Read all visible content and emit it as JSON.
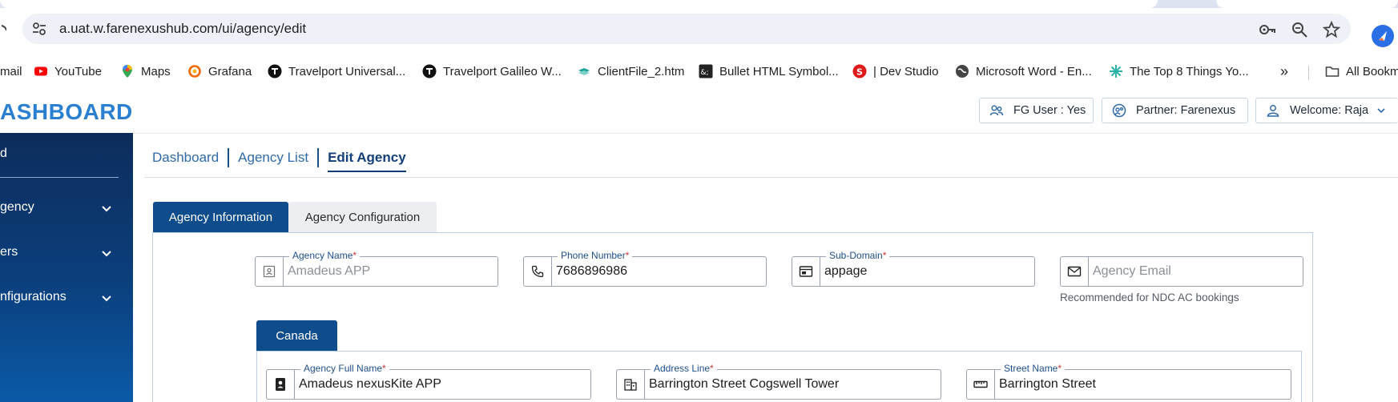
{
  "browser": {
    "url": "a.uat.w.farenexushub.com/ui/agency/edit",
    "bookmarks": [
      {
        "label": "mail",
        "icon": "gmail-icon"
      },
      {
        "label": "YouTube",
        "icon": "youtube-icon"
      },
      {
        "label": "Maps",
        "icon": "maps-icon"
      },
      {
        "label": "Grafana",
        "icon": "grafana-icon"
      },
      {
        "label": "Travelport Universal...",
        "icon": "travelport-icon"
      },
      {
        "label": "Travelport Galileo W...",
        "icon": "travelport-icon"
      },
      {
        "label": "ClientFile_2.htm",
        "icon": "file-icon"
      },
      {
        "label": "Bullet HTML Symbol...",
        "icon": "html-entity-icon"
      },
      {
        "label": "| Dev Studio",
        "icon": "devstudio-icon"
      },
      {
        "label": "Microsoft Word - En...",
        "icon": "globe-icon"
      },
      {
        "label": "The Top 8 Things Yo...",
        "icon": "spark-icon"
      }
    ],
    "more_label": "»",
    "all_bookmarks_label": "All Bookm"
  },
  "header": {
    "brand": "ASHBOARD",
    "fg_user": "FG User : Yes",
    "partner": "Partner: Farenexus",
    "welcome": "Welcome: Raja"
  },
  "sidebar": {
    "items": [
      {
        "label": "d",
        "chevron": false
      },
      {
        "label": "gency",
        "chevron": true
      },
      {
        "label": "ers",
        "chevron": true
      },
      {
        "label": "nfigurations",
        "chevron": true
      }
    ]
  },
  "breadcrumb": {
    "items": [
      "Dashboard",
      "Agency List",
      "Edit Agency"
    ]
  },
  "tabs": {
    "active": "Agency Information",
    "inactive": "Agency Configuration"
  },
  "form": {
    "agency_name": {
      "label": "Agency Name",
      "required": "*",
      "placeholder": "Amadeus APP"
    },
    "phone_number": {
      "label": "Phone Number",
      "required": "*",
      "value": "7686896986"
    },
    "sub_domain": {
      "label": "Sub-Domain",
      "required": "*",
      "value": "appage"
    },
    "agency_email": {
      "placeholder": "Agency Email",
      "hint": "Recommended for NDC AC bookings"
    },
    "country_tab": "Canada",
    "agency_full_name": {
      "label": "Agency Full Name",
      "required": "*",
      "value": "Amadeus nexusKite APP"
    },
    "address_line": {
      "label": "Address Line",
      "required": "*",
      "value": "Barrington Street Cogswell Tower"
    },
    "street_name": {
      "label": "Street Name",
      "required": "*",
      "value": "Barrington Street"
    }
  },
  "colors": {
    "primary": "#0e4c8c",
    "link": "#2e6aa8",
    "required": "#d43333"
  }
}
